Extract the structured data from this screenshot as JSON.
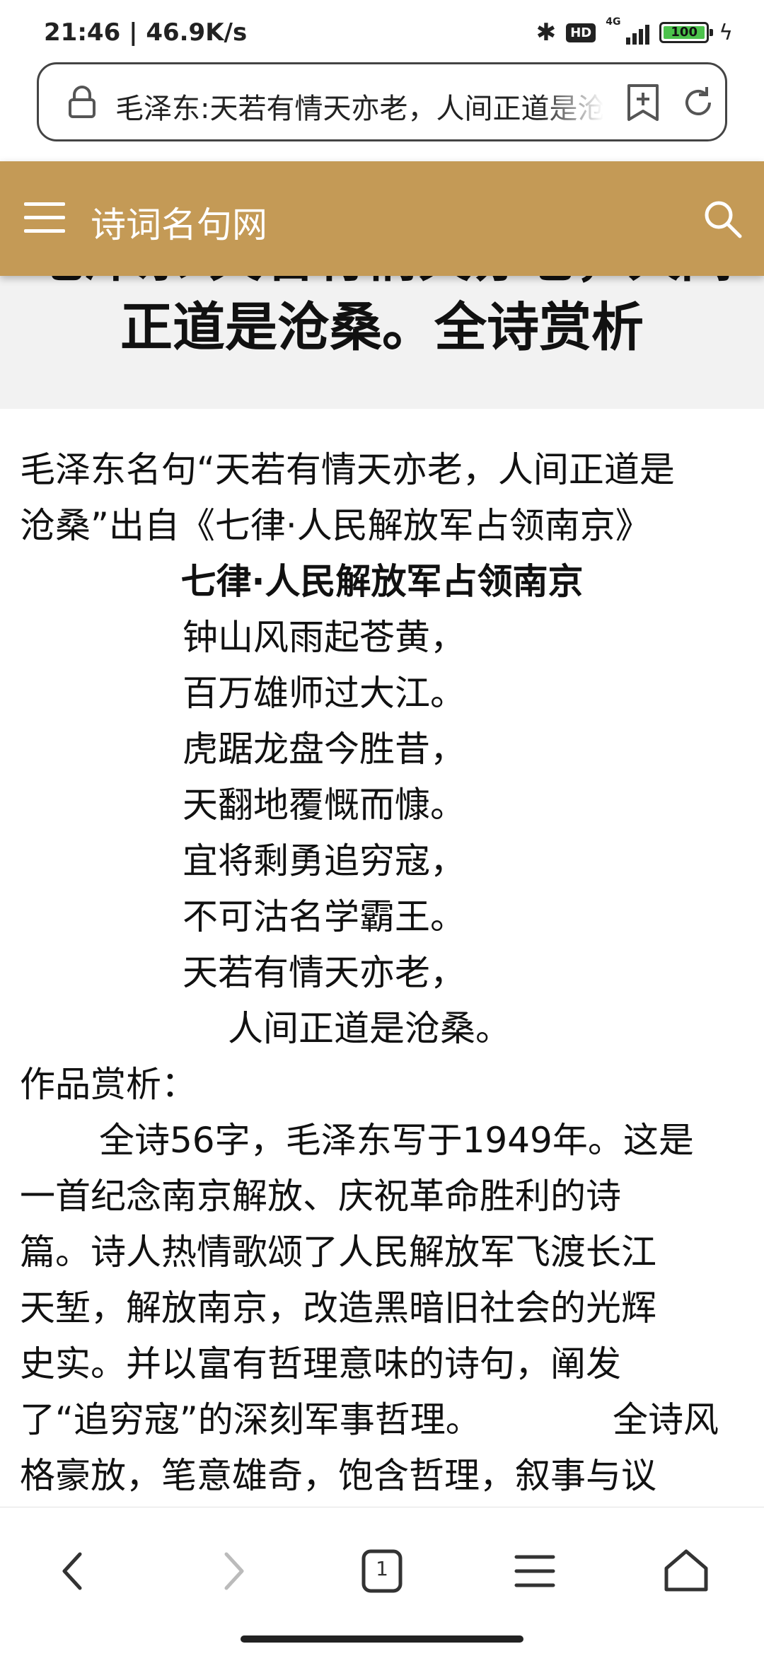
{
  "status_bar": {
    "time_speed": "21:46 | 46.9K/s",
    "hd": "HD",
    "network": "4G",
    "battery": "100",
    "battery_level": 1.0
  },
  "address_bar": {
    "url_text": "毛泽东:天若有情天亦老，人间正道是沧桑。全诗赏析"
  },
  "header": {
    "site_title": "诗词名句网"
  },
  "article": {
    "title": "毛泽东:天若有情天亦老，人间正道是沧桑。全诗赏析",
    "intro_lines": [
      "毛泽东名句“天若有情天亦老，人间正道是",
      "沧桑”出自《七律·人民解放军占领南京》"
    ],
    "poem_title": "七律·人民解放军占领南京",
    "poem_lines": [
      "钟山风雨起苍黄，",
      "百万雄师过大江。",
      "虎踞龙盘今胜昔，",
      "天翻地覆慨而慷。",
      "宜将剩勇追穷寇，",
      "不可沽名学霸王。",
      "天若有情天亦老，",
      "人间正道是沧桑。"
    ],
    "analysis_heading": "作品赏析：",
    "analysis_lines": [
      "全诗56字，毛泽东写于1949年。这是",
      "一首纪念南京解放、庆祝革命胜利的诗",
      "篇。诗人热情歌颂了人民解放军飞渡长江",
      "天堑，解放南京，改造黑暗旧社会的光辉",
      "史实。并以富有哲理意味的诗句，阐发",
      "了“追穷寇”的深刻军事哲理。",
      "全诗风",
      "格豪放，笔意雄奇，饱含哲理，叙事与议"
    ]
  },
  "bottom_nav": {
    "tab_count": "1"
  }
}
